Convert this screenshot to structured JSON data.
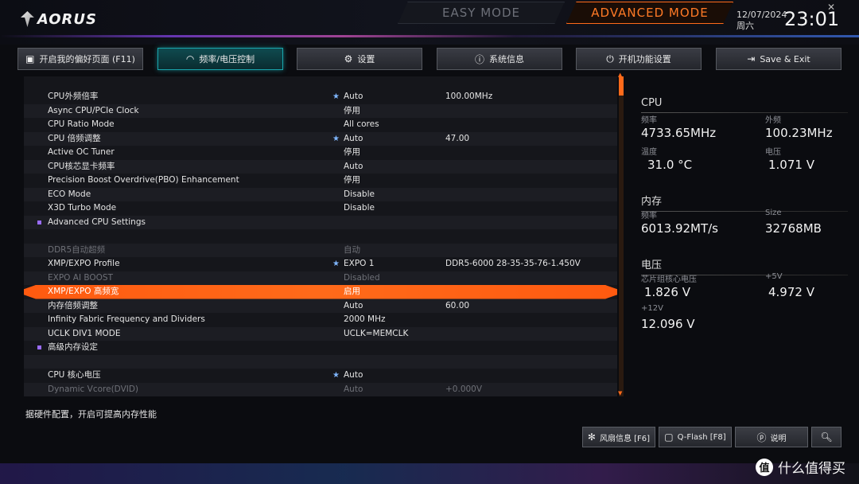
{
  "header": {
    "logo": "AORUS",
    "easy_mode": "EASY MODE",
    "advanced_mode": "ADVANCED MODE",
    "date": "12/07/2024",
    "weekday": "周六",
    "time": "23:01",
    "close_icon": "x-icon"
  },
  "tabs": [
    {
      "label": "开启我的偏好页面 (F11)",
      "icon": "star-box-icon"
    },
    {
      "label": "频率/电压控制",
      "icon": "gauge-icon"
    },
    {
      "label": "设置",
      "icon": "gear-icon"
    },
    {
      "label": "系统信息",
      "icon": "info-icon"
    },
    {
      "label": "开机功能设置",
      "icon": "power-icon"
    },
    {
      "label": "Save & Exit",
      "icon": "exit-icon"
    }
  ],
  "settings": [
    {
      "label": "CPU外频倍率",
      "star": true,
      "value": "Auto",
      "value2": "100.00MHz"
    },
    {
      "label": "Async CPU/PCIe Clock",
      "star": false,
      "value": "停用",
      "value2": ""
    },
    {
      "label": "CPU Ratio Mode",
      "star": false,
      "value": "All cores",
      "value2": ""
    },
    {
      "label": "CPU 倍频调整",
      "star": true,
      "value": "Auto",
      "value2": "47.00"
    },
    {
      "label": "Active OC Tuner",
      "star": false,
      "value": "停用",
      "value2": ""
    },
    {
      "label": "CPU核芯显卡频率",
      "star": false,
      "value": "Auto",
      "value2": ""
    },
    {
      "label": "Precision Boost Overdrive(PBO) Enhancement",
      "star": false,
      "value": "停用",
      "value2": ""
    },
    {
      "label": "ECO Mode",
      "star": false,
      "value": "Disable",
      "value2": ""
    },
    {
      "label": "X3D Turbo Mode",
      "star": false,
      "value": "Disable",
      "value2": ""
    },
    {
      "label": "Advanced CPU Settings",
      "star": false,
      "value": "",
      "value2": "",
      "bullet": true
    },
    {
      "label": "",
      "star": false,
      "value": "",
      "value2": ""
    },
    {
      "label": "DDR5自动超频",
      "star": false,
      "value": "自动",
      "value2": "",
      "dim": true
    },
    {
      "label": "XMP/EXPO Profile",
      "star": true,
      "value": "EXPO 1",
      "value2": "DDR5-6000 28-35-35-76-1.450V"
    },
    {
      "label": "EXPO AI BOOST",
      "star": false,
      "value": "Disabled",
      "value2": "",
      "dim": true
    },
    {
      "label": "XMP/EXPO 高频宽",
      "star": false,
      "value": "启用",
      "value2": "",
      "selected": true
    },
    {
      "label": "内存倍频调整",
      "star": false,
      "value": "Auto",
      "value2": "60.00"
    },
    {
      "label": "Infinity Fabric Frequency and Dividers",
      "star": false,
      "value": "2000 MHz",
      "value2": ""
    },
    {
      "label": "UCLK DIV1 MODE",
      "star": false,
      "value": "UCLK=MEMCLK",
      "value2": ""
    },
    {
      "label": "高级内存设定",
      "star": false,
      "value": "",
      "value2": "",
      "bullet": true
    },
    {
      "label": "",
      "star": false,
      "value": "",
      "value2": ""
    },
    {
      "label": "CPU 核心电压",
      "star": true,
      "value": "Auto",
      "value2": ""
    },
    {
      "label": "Dynamic Vcore(DVID)",
      "star": false,
      "value": "Auto",
      "value2": "+0.000V",
      "dim": true
    }
  ],
  "panel": {
    "cpu": {
      "title": "CPU",
      "freq_label": "频率",
      "freq": "4733.65MHz",
      "bclk_label": "外频",
      "bclk": "100.23MHz",
      "temp_label": "温度",
      "temp": "31.0 °C",
      "volt_label": "电压",
      "volt": "1.071 V"
    },
    "memory": {
      "title": "内存",
      "freq_label": "频率",
      "freq": "6013.92MT/s",
      "size_label": "Size",
      "size": "32768MB"
    },
    "voltage": {
      "title": "电压",
      "chipset_label": "芯片组核心电压",
      "chipset": "1.826 V",
      "v5_label": "+5V",
      "v5": "4.972 V",
      "v12_label": "+12V",
      "v12": "12.096 V"
    }
  },
  "help_text": "据硬件配置，开启可提高内存性能",
  "bottom_buttons": [
    {
      "label": "风扇信息 [F6]",
      "icon": "fan-icon"
    },
    {
      "label": "Q-Flash [F8]",
      "icon": "chip-icon"
    },
    {
      "label": "说明",
      "icon": "help-icon"
    },
    {
      "label": "",
      "icon": "search-icon"
    }
  ],
  "watermark": {
    "badge": "值",
    "text": "什么值得买"
  }
}
